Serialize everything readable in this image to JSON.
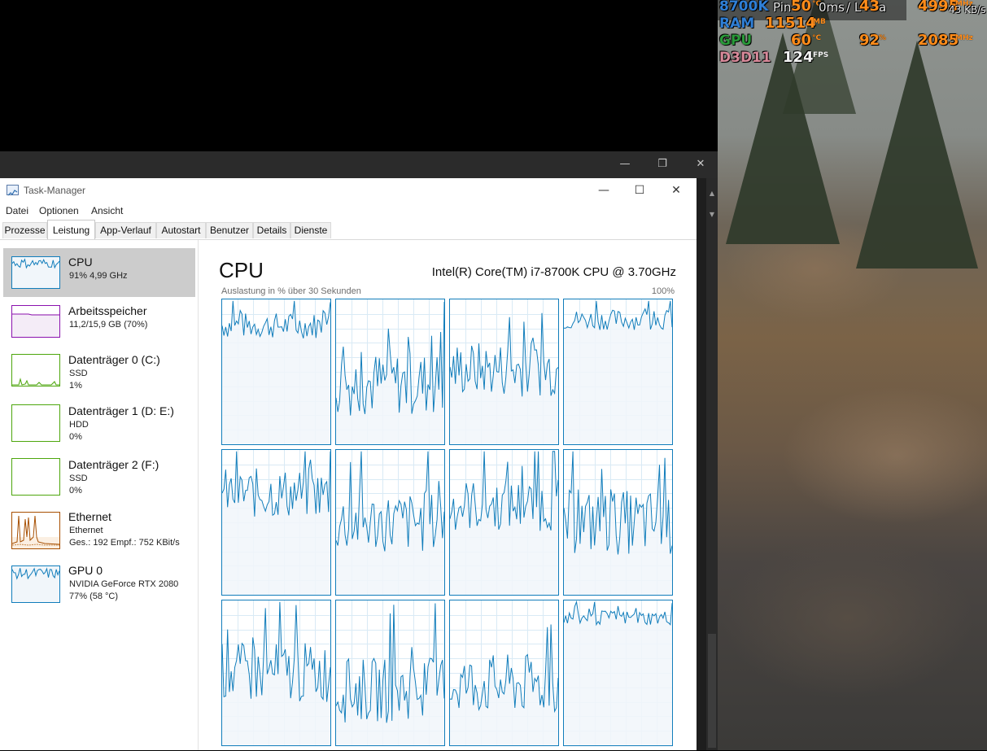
{
  "osd": {
    "row1": {
      "label": "8700K",
      "ping_label": "Pin",
      "temp": "50",
      "temp_unit": "°C",
      "ms_text": "0ms",
      "load_text": "/ L",
      "load": "43",
      "pct_tail": "a",
      "clock": "4995",
      "clock_unit": "MHz",
      "net": "43 KB/s"
    },
    "row2": {
      "label": "RAM",
      "value": "11514",
      "unit": "MB"
    },
    "row3": {
      "label": "GPU",
      "temp": "60",
      "temp_unit": "°C",
      "load": "92",
      "load_unit": "%",
      "clock": "2085",
      "clock_unit": "MHz"
    },
    "row4": {
      "label": "D3D11",
      "value": "124",
      "unit": "FPS"
    }
  },
  "colors": {
    "cpu_line": "#117dbb",
    "cpu_fill": "#f1f6fa",
    "memory": "#8b12ae",
    "disk": "#4da60c",
    "ethernet": "#a74f01",
    "gpu": "#117dbb",
    "osd_blue": "#2f7fd6",
    "osd_orange": "#ff8c1a",
    "osd_green": "#2a9a3a",
    "osd_pink": "#d8899a"
  },
  "window": {
    "title": "Task-Manager"
  },
  "menu": {
    "file": "Datei",
    "options": "Optionen",
    "view": "Ansicht"
  },
  "tabs": [
    {
      "label": "Prozesse"
    },
    {
      "label": "Leistung",
      "active": true
    },
    {
      "label": "App-Verlauf"
    },
    {
      "label": "Autostart"
    },
    {
      "label": "Benutzer"
    },
    {
      "label": "Details"
    },
    {
      "label": "Dienste"
    }
  ],
  "sidebar": {
    "items": [
      {
        "name": "CPU",
        "line1": "91% 4,99 GHz",
        "line2": "",
        "selected": true
      },
      {
        "name": "Arbeitsspeicher",
        "line1": "11,2/15,9 GB (70%)",
        "line2": ""
      },
      {
        "name": "Datenträger 0 (C:)",
        "line1": "SSD",
        "line2": "1%"
      },
      {
        "name": "Datenträger 1 (D: E:)",
        "line1": "HDD",
        "line2": "0%"
      },
      {
        "name": "Datenträger 2 (F:)",
        "line1": "SSD",
        "line2": "0%"
      },
      {
        "name": "Ethernet",
        "line1": "Ethernet",
        "line2": "Ges.: 192  Empf.: 752 KBit/s"
      },
      {
        "name": "GPU 0",
        "line1": "NVIDIA GeForce RTX 2080",
        "line2": "77% (58 °C)"
      }
    ]
  },
  "main": {
    "title": "CPU",
    "model": "Intel(R) Core(TM) i7-8700K CPU @ 3.70GHz",
    "usage_label": "Auslastung in % über 30 Sekunden",
    "usage_max": "100%",
    "cores": [
      {
        "level": 0.82,
        "var": 0.18
      },
      {
        "level": 0.42,
        "var": 0.45
      },
      {
        "level": 0.52,
        "var": 0.38
      },
      {
        "level": 0.86,
        "var": 0.14
      },
      {
        "level": 0.7,
        "var": 0.35
      },
      {
        "level": 0.5,
        "var": 0.42
      },
      {
        "level": 0.62,
        "var": 0.36
      },
      {
        "level": 0.5,
        "var": 0.45
      },
      {
        "level": 0.5,
        "var": 0.42
      },
      {
        "level": 0.38,
        "var": 0.45
      },
      {
        "level": 0.42,
        "var": 0.42
      },
      {
        "level": 0.88,
        "var": 0.1
      }
    ]
  }
}
